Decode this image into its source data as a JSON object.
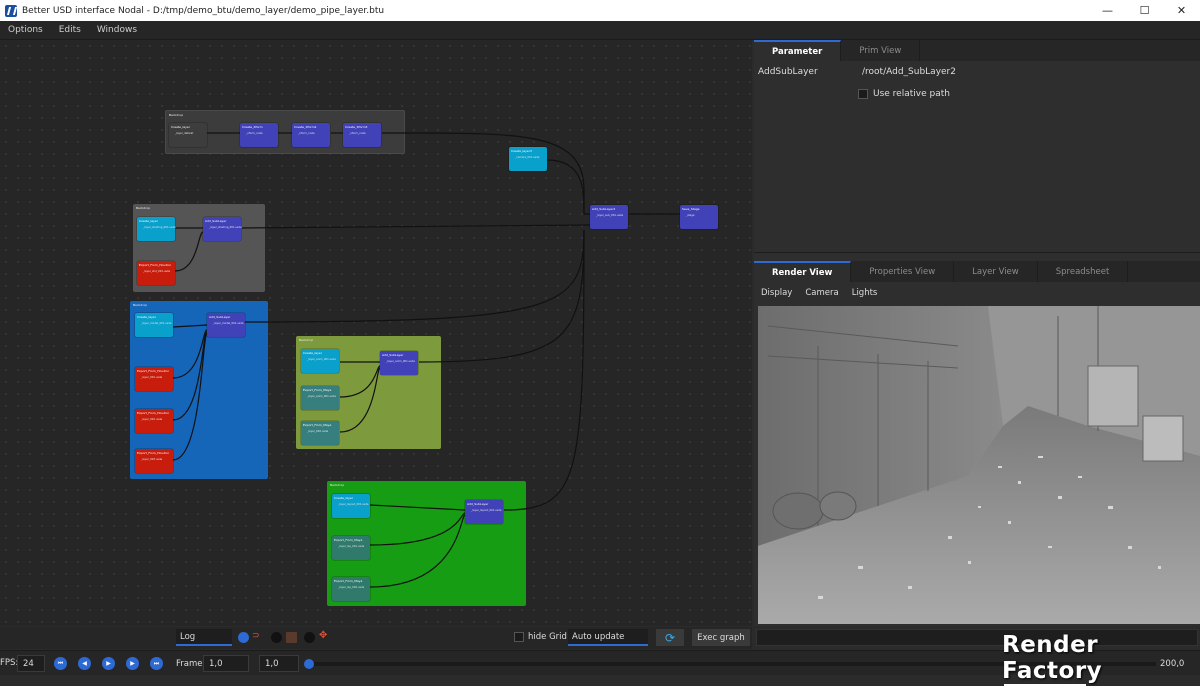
{
  "window": {
    "title": "Better USD interface Nodal - D:/tmp/demo_btu/demo_layer/demo_pipe_layer.btu"
  },
  "menu": [
    "Options",
    "Edits",
    "Windows"
  ],
  "right_tabs": [
    {
      "label": "Parameter",
      "active": true
    },
    {
      "label": "Prim View",
      "active": false
    }
  ],
  "parameter": {
    "name": "AddSubLayer",
    "value": "/root/Add_SubLayer2",
    "relative_label": "Use relative path"
  },
  "render_tabs": [
    {
      "label": "Render View",
      "active": true
    },
    {
      "label": "Properties View",
      "active": false
    },
    {
      "label": "Layer View",
      "active": false
    },
    {
      "label": "Spreadsheet",
      "active": false
    }
  ],
  "render_subbar": [
    "Display",
    "Camera",
    "Lights"
  ],
  "toolbar": {
    "log": "Log",
    "hide_grid": "hide Grid",
    "auto_update": "Auto update",
    "exec": "Exec graph"
  },
  "timeline": {
    "fps_label": "FPS:",
    "fps": "24",
    "frame_label": "Frame:",
    "frame_start": "1,0",
    "frame_current": "1,0",
    "frame_end": "200,0"
  },
  "watermark": "Render Factory",
  "colors": {
    "accent": "#2d6ad6",
    "backdrop_grey": "#555555",
    "backdrop_blue": "#1565b8",
    "backdrop_olive": "#7d9a3c",
    "backdrop_green": "#179d13"
  }
}
